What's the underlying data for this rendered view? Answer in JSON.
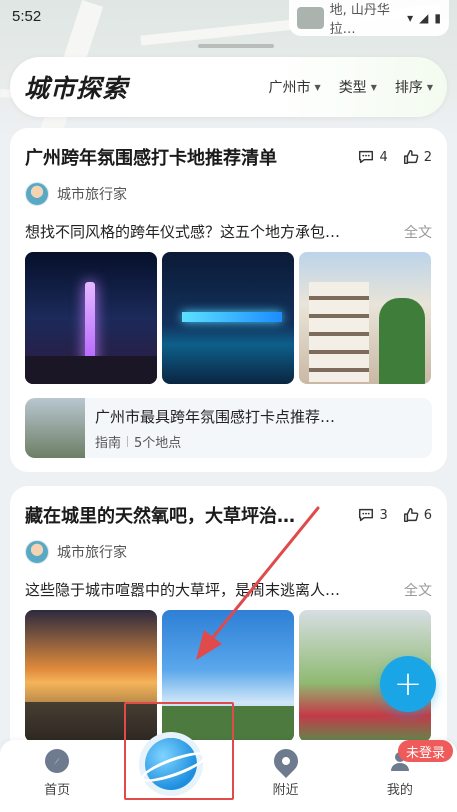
{
  "status_bar": {
    "time": "5:52"
  },
  "map_peek": {
    "text": "地, 山丹华拉…"
  },
  "header": {
    "logo": "城市探索",
    "filters": [
      "广州市",
      "类型",
      "排序"
    ]
  },
  "cards": [
    {
      "title": "广州跨年氛围感打卡地推荐清单",
      "comments": "4",
      "likes": "2",
      "author": "城市旅行家",
      "excerpt": "想找不同风格的跨年仪式感？这五个地方承包…",
      "full_link": "全文",
      "sub": {
        "title": "广州市最具跨年氛围感打卡点推荐…",
        "tag": "指南",
        "count": "5个地点"
      }
    },
    {
      "title": "藏在城里的天然氧吧，大草坪治…",
      "comments": "3",
      "likes": "6",
      "author": "城市旅行家",
      "excerpt": "这些隐于城市喧嚣中的大草坪，是周末逃离人…",
      "full_link": "全文"
    }
  ],
  "tabbar": {
    "items": [
      "首页",
      "附近",
      "我的"
    ],
    "login_badge": "未登录"
  },
  "colors": {
    "accent": "#1aa6e6",
    "badge": "#ef5a5a",
    "highlight": "#e04a4a",
    "logo_mark": "#c4ec5b"
  }
}
